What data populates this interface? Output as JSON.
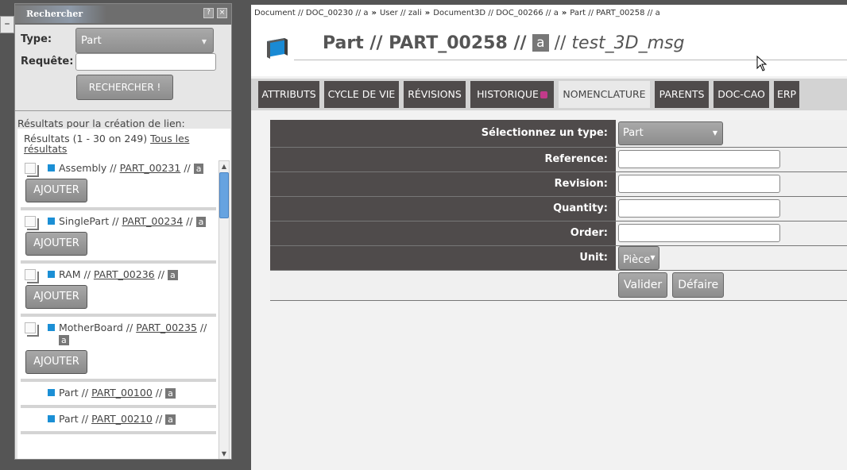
{
  "search": {
    "title": "Rechercher",
    "help_icon": "?",
    "close_icon": "×",
    "type_label": "Type:",
    "type_value": "Part",
    "query_label": "Requête:",
    "query_value": "",
    "search_button": "RECHERCHER !",
    "results_title": "Résultats pour la création de lien:",
    "results_count": "Résultats (1 - 30 on 249)",
    "all_results_link": "Tous les résultats",
    "add_label": "AJOUTER",
    "results": [
      {
        "type": "Assembly",
        "sep1": " // ",
        "ref": "PART_00231",
        "sep2": " // ",
        "rev": "a",
        "addable": true
      },
      {
        "type": "SinglePart",
        "sep1": " // ",
        "ref": "PART_00234",
        "sep2": " // ",
        "rev": "a",
        "addable": true
      },
      {
        "type": "RAM",
        "sep1": " // ",
        "ref": "PART_00236",
        "sep2": " // ",
        "rev": "a",
        "addable": true
      },
      {
        "type": "MotherBoard",
        "sep1": " // ",
        "ref": "PART_00235",
        "sep2": " // ",
        "rev": "a",
        "addable": true
      },
      {
        "type": "Part",
        "sep1": " // ",
        "ref": "PART_00100",
        "sep2": " // ",
        "rev": "a",
        "addable": false
      },
      {
        "type": "Part",
        "sep1": " // ",
        "ref": "PART_00210",
        "sep2": " // ",
        "rev": "a",
        "addable": false
      }
    ]
  },
  "toggle_label": "–",
  "breadcrumb": [
    "Document // DOC_00230 // a",
    "User // zali",
    "Document3D // DOC_00266 // a",
    "Part // PART_00258 // a"
  ],
  "breadcrumb_sep": "»",
  "title": {
    "type": "Part",
    "sep": " // ",
    "reference": "PART_00258",
    "revision": "a",
    "name": "test_3D_msg"
  },
  "tabs": [
    "ATTRIBUTS",
    "CYCLE DE VIE",
    "RÉVISIONS",
    "HISTORIQUE",
    "NOMENCLATURE",
    "PARENTS",
    "DOC-CAO",
    "ERP"
  ],
  "active_tab": "NOMENCLATURE",
  "form": {
    "type_label": "Sélectionnez un type:",
    "type_value": "Part",
    "reference_label": "Reference:",
    "revision_label": "Revision:",
    "quantity_label": "Quantity:",
    "order_label": "Order:",
    "unit_label": "Unit:",
    "unit_value": "Pièce",
    "validate_button": "Valider",
    "undo_button": "Défaire"
  },
  "colors": {
    "accent": "#1b8fd5",
    "tab_bg": "#4f4b4b",
    "button": "#9a9a9a"
  }
}
